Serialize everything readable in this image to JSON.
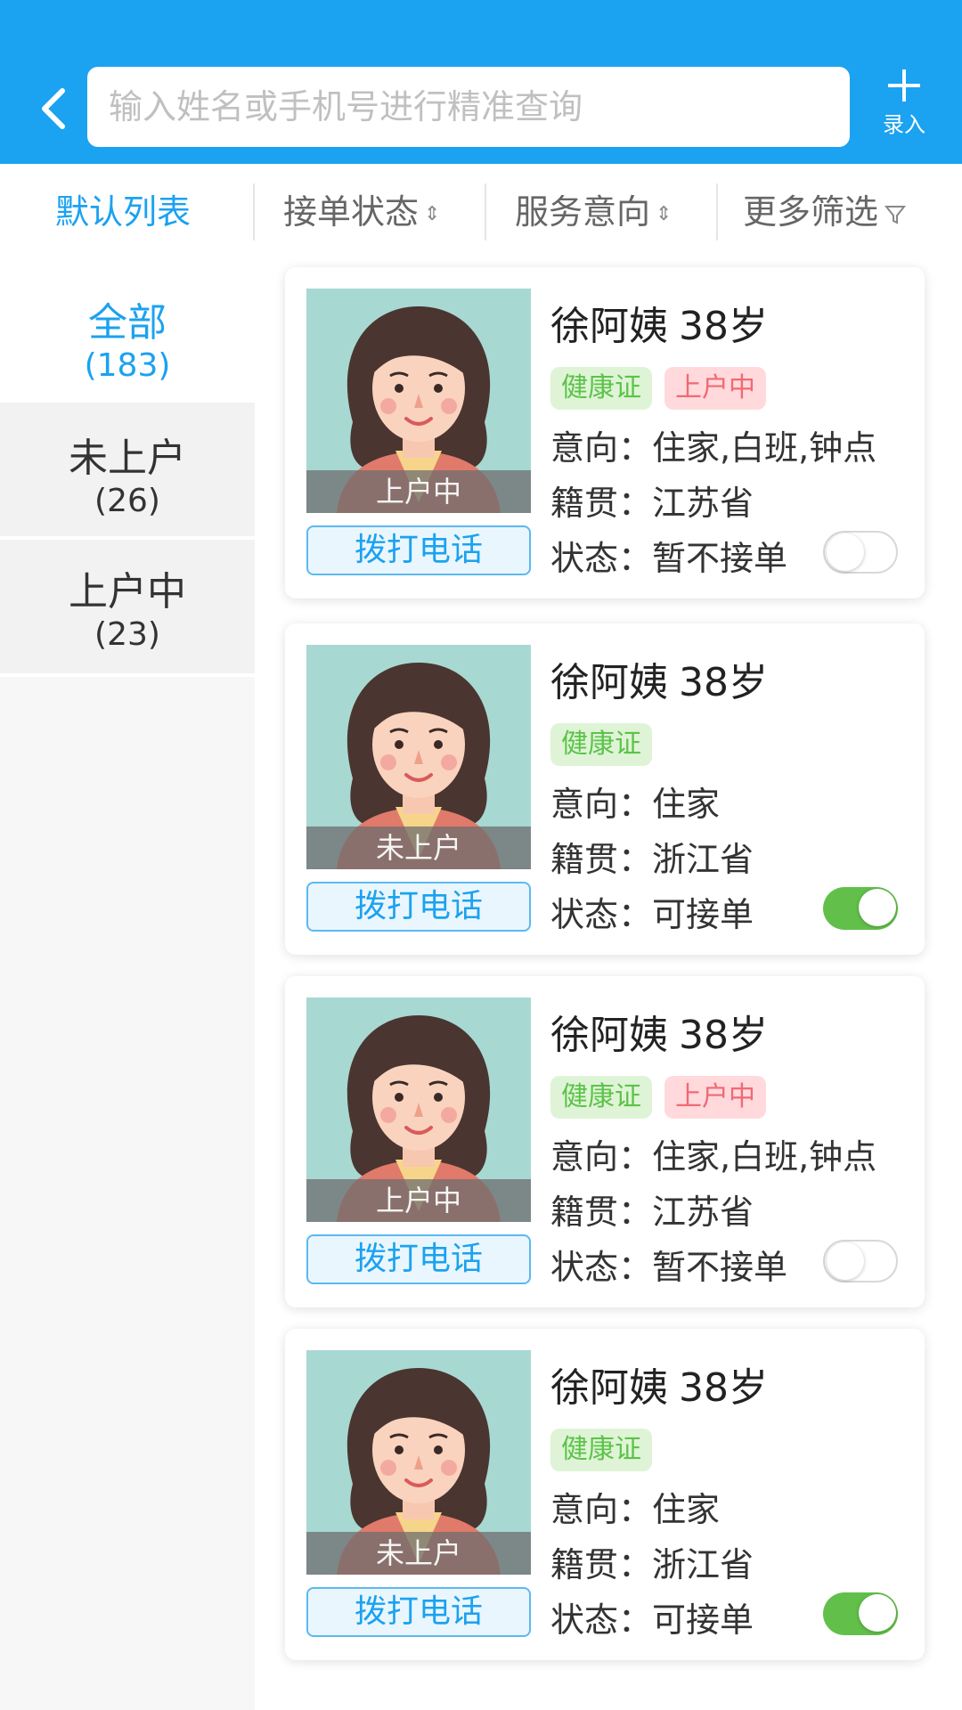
{
  "header": {
    "search_placeholder": "输入姓名或手机号进行精准查询",
    "add_label": "录入",
    "accent": "#1BA2F0"
  },
  "filters": {
    "default_list": "默认列表",
    "order_status": "接单状态",
    "service_intent": "服务意向",
    "more_filters": "更多筛选"
  },
  "sidebar": {
    "items": [
      {
        "name": "全部",
        "count": "(183)"
      },
      {
        "name": "未上户",
        "count": "(26)"
      },
      {
        "name": "上户中",
        "count": "(23)"
      }
    ]
  },
  "cards": [
    {
      "name": "徐阿姨",
      "age": "38岁",
      "photo_status": "上户中",
      "tag_health": "健康证",
      "tag_status": "上户中",
      "intent": "意向：住家,白班,钟点",
      "origin": "籍贯：江苏省",
      "status": "状态：暂不接单",
      "toggle_on": false,
      "call": "拨打电话"
    },
    {
      "name": "徐阿姨",
      "age": "38岁",
      "photo_status": "未上户",
      "tag_health": "健康证",
      "tag_status": "",
      "intent": "意向：住家",
      "origin": "籍贯：浙江省",
      "status": "状态：可接单",
      "toggle_on": true,
      "call": "拨打电话"
    },
    {
      "name": "徐阿姨",
      "age": "38岁",
      "photo_status": "上户中",
      "tag_health": "健康证",
      "tag_status": "上户中",
      "intent": "意向：住家,白班,钟点",
      "origin": "籍贯：江苏省",
      "status": "状态：暂不接单",
      "toggle_on": false,
      "call": "拨打电话"
    },
    {
      "name": "徐阿姨",
      "age": "38岁",
      "photo_status": "未上户",
      "tag_health": "健康证",
      "tag_status": "",
      "intent": "意向：住家",
      "origin": "籍贯：浙江省",
      "status": "状态：可接单",
      "toggle_on": true,
      "call": "拨打电话"
    }
  ]
}
